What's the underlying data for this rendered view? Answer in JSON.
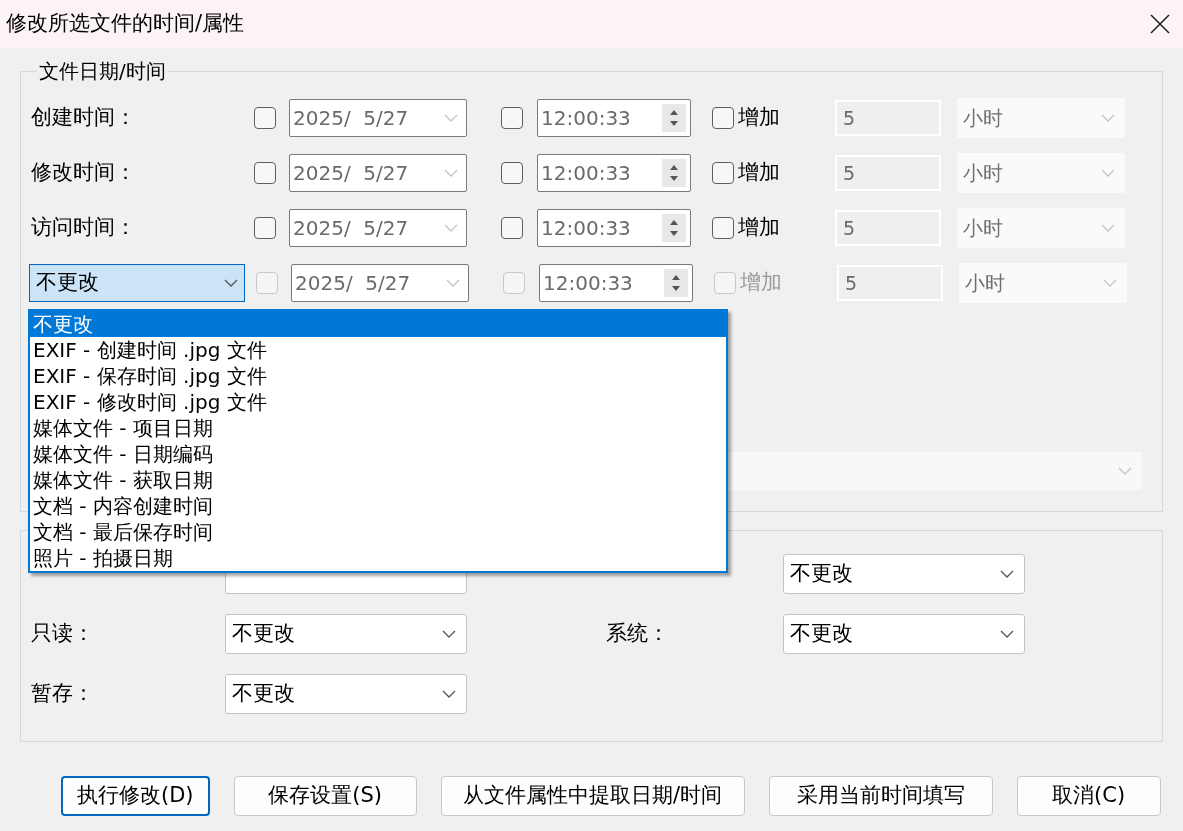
{
  "window": {
    "title": "修改所选文件的时间/属性"
  },
  "date_group": {
    "title": "文件日期/时间",
    "rows": [
      {
        "kind": "label",
        "label": "创建时间：",
        "disabled": false,
        "date_checked": false,
        "date": "2025/  5/27",
        "time_checked": false,
        "time": "12:00:33",
        "add_checked": false,
        "add_label": "增加",
        "amount": "5",
        "unit": "小时"
      },
      {
        "kind": "label",
        "label": "修改时间：",
        "disabled": false,
        "date_checked": false,
        "date": "2025/  5/27",
        "time_checked": false,
        "time": "12:00:33",
        "add_checked": false,
        "add_label": "增加",
        "amount": "5",
        "unit": "小时"
      },
      {
        "kind": "label",
        "label": "访问时间：",
        "disabled": false,
        "date_checked": false,
        "date": "2025/  5/27",
        "time_checked": false,
        "time": "12:00:33",
        "add_checked": false,
        "add_label": "增加",
        "amount": "5",
        "unit": "小时"
      },
      {
        "kind": "source",
        "label": "不更改",
        "disabled": true,
        "date_checked": false,
        "date": "2025/  5/27",
        "time_checked": false,
        "time": "12:00:33",
        "add_checked": false,
        "add_label": "增加",
        "amount": "5",
        "unit": "小时"
      }
    ]
  },
  "source_dropdown": {
    "options": [
      {
        "label": "不更改",
        "selected": true
      },
      {
        "label": "EXIF - 创建时间 .jpg 文件",
        "selected": false
      },
      {
        "label": "EXIF - 保存时间 .jpg 文件",
        "selected": false
      },
      {
        "label": "EXIF - 修改时间 .jpg 文件",
        "selected": false
      },
      {
        "label": "媒体文件 - 项目日期",
        "selected": false
      },
      {
        "label": "媒体文件 - 日期编码",
        "selected": false
      },
      {
        "label": "媒体文件 - 获取日期",
        "selected": false
      },
      {
        "label": "文档 - 内容创建时间",
        "selected": false
      },
      {
        "label": "文档 - 最后保存时间",
        "selected": false
      },
      {
        "label": "照片 - 拍摄日期",
        "selected": false
      }
    ]
  },
  "attributes_group": {
    "fields": [
      {
        "value": "不更改"
      },
      {
        "label": "只读：",
        "value": "不更改"
      },
      {
        "label": "系统：",
        "value": "不更改"
      },
      {
        "label": "暂存：",
        "value": "不更改"
      }
    ]
  },
  "buttons": [
    {
      "label": "执行修改(D)",
      "focused": true
    },
    {
      "label": "保存设置(S)",
      "focused": false
    },
    {
      "label": "从文件属性中提取日期/时间",
      "focused": false
    },
    {
      "label": "采用当前时间填写",
      "focused": false
    },
    {
      "label": "取消(C)",
      "focused": false
    }
  ]
}
